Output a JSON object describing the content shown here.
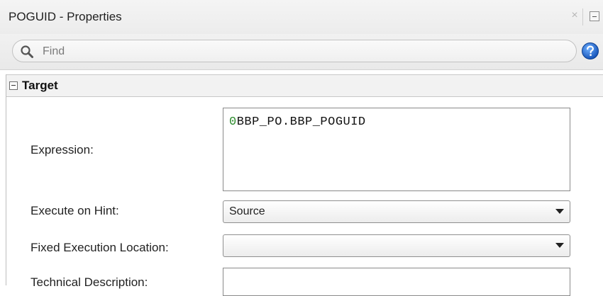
{
  "window": {
    "title": "POGUID - Properties",
    "close_glyph": "×"
  },
  "find": {
    "placeholder": "Find"
  },
  "icons": {
    "search": "search-icon",
    "help": "help-icon",
    "close": "close-icon",
    "minimize": "minimize-icon",
    "collapse": "collapse-icon",
    "dropdown": "chevron-down-icon"
  },
  "section": {
    "title": "Target"
  },
  "fields": {
    "expression": {
      "label": "Expression:",
      "cursor_char": "0",
      "value": "BBP_PO.BBP_POGUID"
    },
    "execute_on_hint": {
      "label": "Execute on Hint:",
      "value": "Source"
    },
    "fixed_execution_location": {
      "label": "Fixed Execution Location:",
      "value": ""
    },
    "technical_description": {
      "label": "Technical Description:"
    }
  },
  "colors": {
    "help_blue": "#1f6fd1",
    "header_bg": "#f2f2f2"
  }
}
